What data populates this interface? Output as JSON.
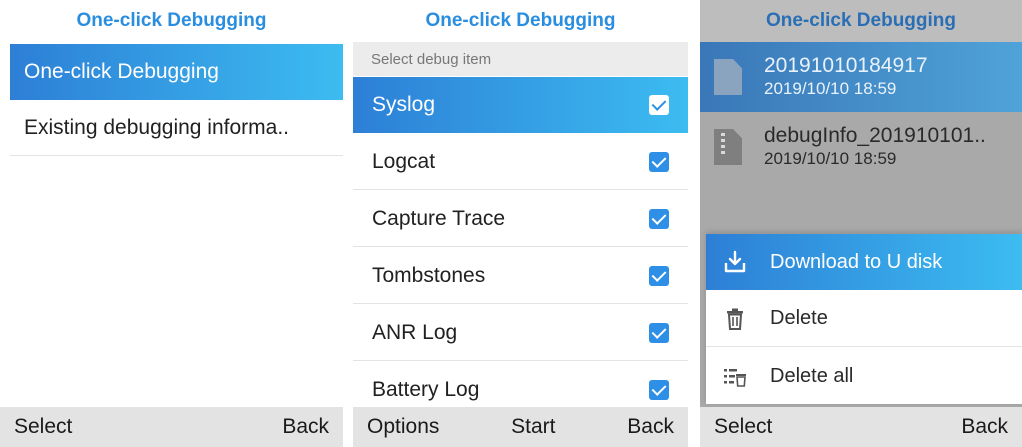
{
  "screen1": {
    "title": "One-click Debugging",
    "items": [
      {
        "label": "One-click Debugging"
      },
      {
        "label": "Existing debugging informa.."
      }
    ],
    "softkeys": {
      "left": "Select",
      "right": "Back"
    }
  },
  "screen2": {
    "title": "One-click Debugging",
    "subheader": "Select debug item",
    "items": [
      {
        "label": "Syslog",
        "checked": true
      },
      {
        "label": "Logcat",
        "checked": true
      },
      {
        "label": "Capture Trace",
        "checked": true
      },
      {
        "label": "Tombstones",
        "checked": true
      },
      {
        "label": "ANR Log",
        "checked": true
      },
      {
        "label": "Battery Log",
        "checked": true
      }
    ],
    "softkeys": {
      "left": "Options",
      "center": "Start",
      "right": "Back"
    }
  },
  "screen3": {
    "title": "One-click Debugging",
    "files": [
      {
        "name": "20191010184917",
        "date": "2019/10/10  18:59",
        "icon": "file-icon"
      },
      {
        "name": "debugInfo_201910101..",
        "date": "2019/10/10  18:59",
        "icon": "zip-file-icon"
      }
    ],
    "menu": [
      {
        "label": "Download to U disk",
        "icon": "download-icon"
      },
      {
        "label": "Delete",
        "icon": "trash-icon"
      },
      {
        "label": "Delete all",
        "icon": "delete-all-icon"
      }
    ],
    "softkeys": {
      "left": "Select",
      "right": "Back"
    }
  },
  "colors": {
    "accent": "#2a8ee0",
    "selection_start": "#2d7fd6",
    "selection_end": "#3cbcf1",
    "softkey_bar": "#e3e3e3"
  }
}
